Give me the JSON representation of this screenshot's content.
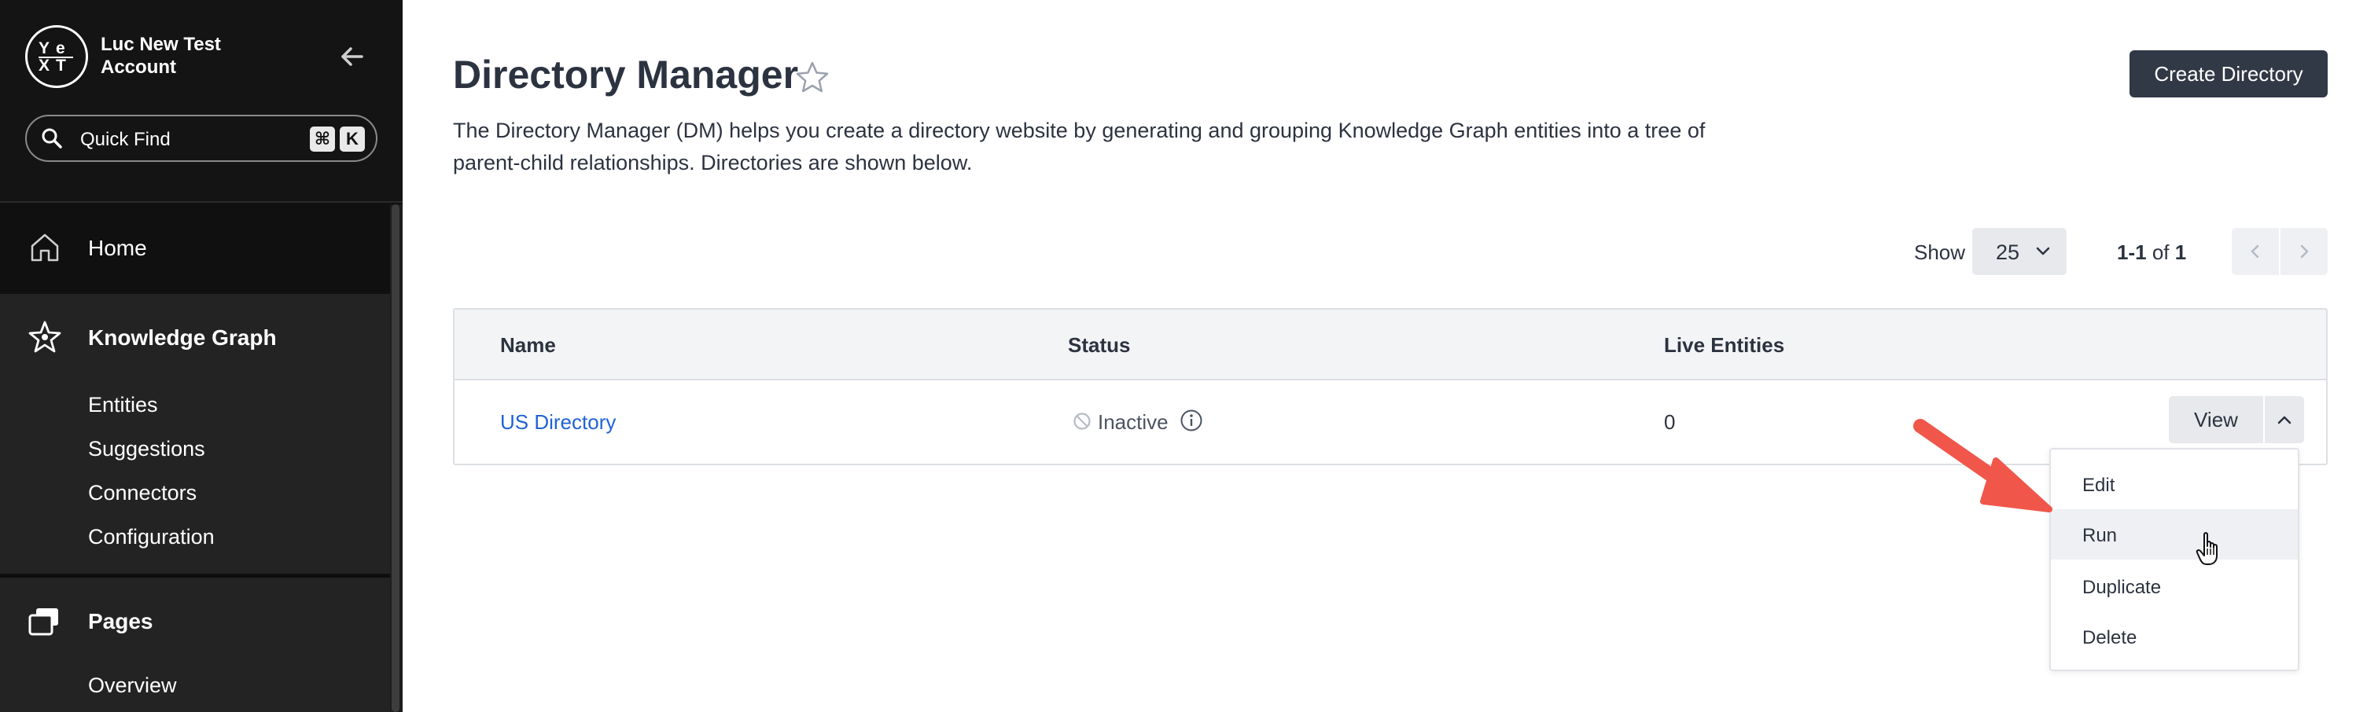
{
  "sidebar": {
    "logo_text": "YEXT",
    "account_name": "Luc New Test Account",
    "quick_find": {
      "label": "Quick Find",
      "shortcut_mod": "⌘",
      "shortcut_key": "K"
    },
    "home": {
      "label": "Home"
    },
    "knowledge_graph": {
      "label": "Knowledge Graph",
      "items": [
        {
          "label": "Entities"
        },
        {
          "label": "Suggestions"
        },
        {
          "label": "Connectors"
        },
        {
          "label": "Configuration"
        }
      ]
    },
    "pages": {
      "label": "Pages",
      "items": [
        {
          "label": "Overview"
        }
      ]
    }
  },
  "main": {
    "title": "Directory Manager",
    "description": "The Directory Manager (DM) helps you create a directory website by generating and grouping Knowledge Graph entities into a tree of parent-child relationships. Directories are shown below.",
    "create_button": "Create Directory",
    "pagination": {
      "show_label": "Show",
      "page_size": "25",
      "range": "1-1",
      "of_label": "of",
      "total": "1"
    },
    "table": {
      "columns": [
        "Name",
        "Status",
        "Live Entities"
      ],
      "rows": [
        {
          "name": "US Directory",
          "status": "Inactive",
          "live_entities": "0",
          "action": "View"
        }
      ]
    },
    "row_menu": {
      "items": [
        "Edit",
        "Run",
        "Duplicate",
        "Delete"
      ],
      "hovered": "Run"
    }
  },
  "colors": {
    "sidebar_bg": "#101010",
    "accent_link": "#1f63d6",
    "primary_button": "#313846",
    "annotation_arrow": "#f0564a"
  }
}
